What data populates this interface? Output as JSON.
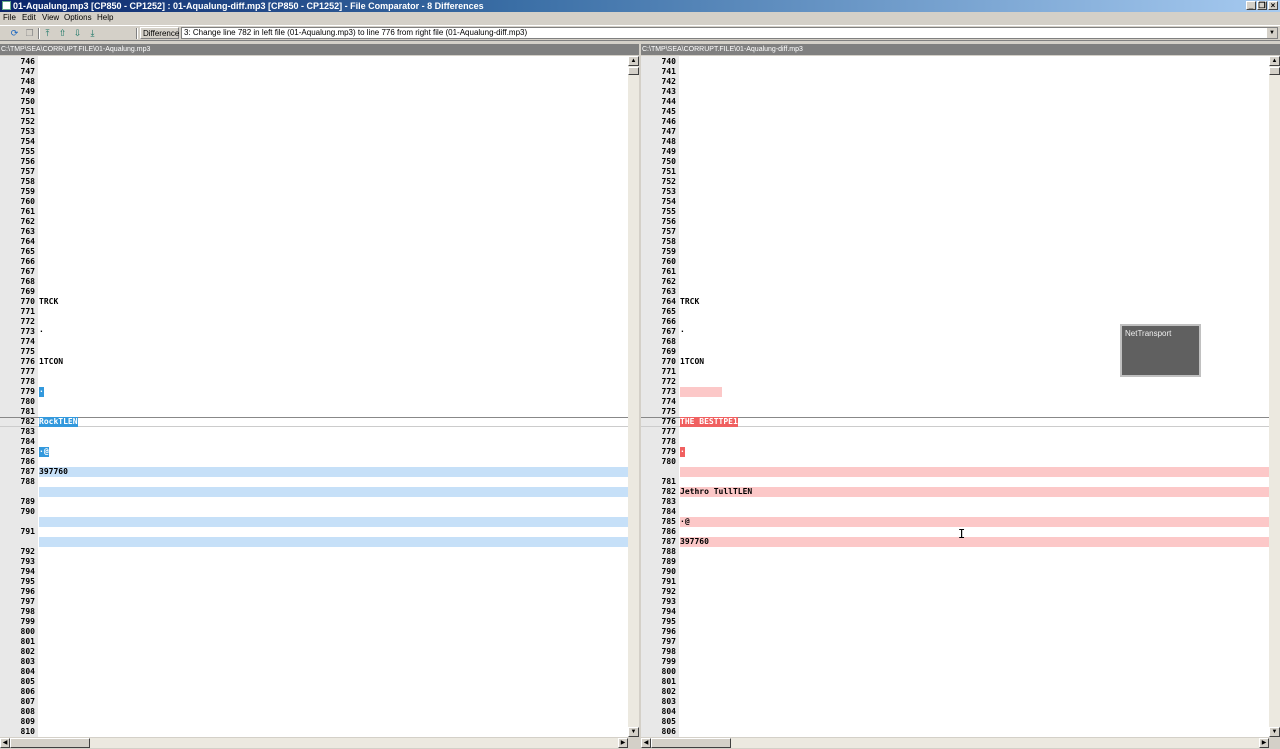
{
  "window": {
    "title": "01-Aqualung.mp3 [CP850 - CP1252] : 01-Aqualung-diff.mp3 [CP850 - CP1252] - File Comparator - 8 Differences",
    "controls": [
      "_",
      "❐",
      "×"
    ]
  },
  "menu": [
    {
      "label": "File"
    },
    {
      "label": "Edit"
    },
    {
      "label": "View"
    },
    {
      "label": "Options"
    },
    {
      "label": "Help"
    }
  ],
  "toolbar": {
    "difference_label": "Difference",
    "difference_value": "3: Change line 782 in left file (01-Aqualung.mp3) to line 776 from right file (01-Aqualung-diff.mp3)"
  },
  "left_pane": {
    "path": "C:\\TMP\\SEA\\CORRUPT.FILE\\01-Aqualung.mp3"
  },
  "right_pane": {
    "path": "C:\\TMP\\SEA\\CORRUPT.FILE\\01-Aqualung-diff.mp3"
  },
  "left_lines": [
    {
      "n": "746",
      "t": ""
    },
    {
      "n": "747",
      "t": ""
    },
    {
      "n": "748",
      "t": ""
    },
    {
      "n": "749",
      "t": ""
    },
    {
      "n": "750",
      "t": ""
    },
    {
      "n": "751",
      "t": ""
    },
    {
      "n": "752",
      "t": ""
    },
    {
      "n": "753",
      "t": ""
    },
    {
      "n": "754",
      "t": ""
    },
    {
      "n": "755",
      "t": ""
    },
    {
      "n": "756",
      "t": ""
    },
    {
      "n": "757",
      "t": ""
    },
    {
      "n": "758",
      "t": ""
    },
    {
      "n": "759",
      "t": ""
    },
    {
      "n": "760",
      "t": ""
    },
    {
      "n": "761",
      "t": ""
    },
    {
      "n": "762",
      "t": ""
    },
    {
      "n": "763",
      "t": ""
    },
    {
      "n": "764",
      "t": ""
    },
    {
      "n": "765",
      "t": ""
    },
    {
      "n": "766",
      "t": ""
    },
    {
      "n": "767",
      "t": ""
    },
    {
      "n": "768",
      "t": ""
    },
    {
      "n": "769",
      "t": ""
    },
    {
      "n": "770",
      "t": "TRCK"
    },
    {
      "n": "771",
      "t": ""
    },
    {
      "n": "772",
      "t": ""
    },
    {
      "n": "773",
      "t": "·"
    },
    {
      "n": "774",
      "t": ""
    },
    {
      "n": "775",
      "t": ""
    },
    {
      "n": "776",
      "t": "1TCON"
    },
    {
      "n": "777",
      "t": ""
    },
    {
      "n": "778",
      "t": ""
    },
    {
      "n": "779",
      "t": "·",
      "sel": "blue"
    },
    {
      "n": "780",
      "t": ""
    },
    {
      "n": "781",
      "t": ""
    },
    {
      "n": "782",
      "t": "RockTLEN",
      "sel": "blue",
      "current": true
    },
    {
      "n": "783",
      "t": ""
    },
    {
      "n": "784",
      "t": ""
    },
    {
      "n": "785",
      "t": "·@",
      "sel": "blue"
    },
    {
      "n": "786",
      "t": ""
    },
    {
      "n": "787",
      "t": "397760",
      "hl": "blue"
    },
    {
      "n": "788",
      "t": ""
    },
    {
      "n": "",
      "t": "",
      "hl": "blue"
    },
    {
      "n": "789",
      "t": ""
    },
    {
      "n": "790",
      "t": ""
    },
    {
      "n": "",
      "t": "",
      "hl": "blue"
    },
    {
      "n": "791",
      "t": ""
    },
    {
      "n": "",
      "t": "",
      "hl": "blue"
    },
    {
      "n": "792",
      "t": ""
    },
    {
      "n": "793",
      "t": ""
    },
    {
      "n": "794",
      "t": ""
    },
    {
      "n": "795",
      "t": ""
    },
    {
      "n": "796",
      "t": ""
    },
    {
      "n": "797",
      "t": ""
    },
    {
      "n": "798",
      "t": ""
    },
    {
      "n": "799",
      "t": ""
    },
    {
      "n": "800",
      "t": ""
    },
    {
      "n": "801",
      "t": ""
    },
    {
      "n": "802",
      "t": ""
    },
    {
      "n": "803",
      "t": ""
    },
    {
      "n": "804",
      "t": ""
    },
    {
      "n": "805",
      "t": ""
    },
    {
      "n": "806",
      "t": ""
    },
    {
      "n": "807",
      "t": ""
    },
    {
      "n": "808",
      "t": ""
    },
    {
      "n": "809",
      "t": ""
    },
    {
      "n": "810",
      "t": ""
    }
  ],
  "right_lines": [
    {
      "n": "740",
      "t": ""
    },
    {
      "n": "741",
      "t": ""
    },
    {
      "n": "742",
      "t": ""
    },
    {
      "n": "743",
      "t": ""
    },
    {
      "n": "744",
      "t": ""
    },
    {
      "n": "745",
      "t": ""
    },
    {
      "n": "746",
      "t": ""
    },
    {
      "n": "747",
      "t": ""
    },
    {
      "n": "748",
      "t": ""
    },
    {
      "n": "749",
      "t": ""
    },
    {
      "n": "750",
      "t": ""
    },
    {
      "n": "751",
      "t": ""
    },
    {
      "n": "752",
      "t": ""
    },
    {
      "n": "753",
      "t": ""
    },
    {
      "n": "754",
      "t": ""
    },
    {
      "n": "755",
      "t": ""
    },
    {
      "n": "756",
      "t": ""
    },
    {
      "n": "757",
      "t": ""
    },
    {
      "n": "758",
      "t": ""
    },
    {
      "n": "759",
      "t": ""
    },
    {
      "n": "760",
      "t": ""
    },
    {
      "n": "761",
      "t": ""
    },
    {
      "n": "762",
      "t": ""
    },
    {
      "n": "763",
      "t": ""
    },
    {
      "n": "764",
      "t": "TRCK"
    },
    {
      "n": "765",
      "t": ""
    },
    {
      "n": "766",
      "t": ""
    },
    {
      "n": "767",
      "t": "·"
    },
    {
      "n": "768",
      "t": ""
    },
    {
      "n": "769",
      "t": ""
    },
    {
      "n": "770",
      "t": "1TCON"
    },
    {
      "n": "771",
      "t": ""
    },
    {
      "n": "772",
      "t": ""
    },
    {
      "n": "773",
      "t": "",
      "small": "red"
    },
    {
      "n": "774",
      "t": ""
    },
    {
      "n": "775",
      "t": ""
    },
    {
      "n": "776",
      "t": "THE BESTTPE1",
      "sel": "red",
      "current": true
    },
    {
      "n": "777",
      "t": ""
    },
    {
      "n": "778",
      "t": ""
    },
    {
      "n": "779",
      "t": "·",
      "sel": "red"
    },
    {
      "n": "780",
      "t": ""
    },
    {
      "n": "",
      "t": "",
      "hl": "red"
    },
    {
      "n": "781",
      "t": ""
    },
    {
      "n": "782",
      "t": "Jethro TullTLEN",
      "hl": "red"
    },
    {
      "n": "783",
      "t": ""
    },
    {
      "n": "784",
      "t": ""
    },
    {
      "n": "785",
      "t": "·@",
      "hl": "red"
    },
    {
      "n": "786",
      "t": ""
    },
    {
      "n": "787",
      "t": "397760",
      "hl": "red"
    },
    {
      "n": "788",
      "t": ""
    },
    {
      "n": "789",
      "t": ""
    },
    {
      "n": "790",
      "t": ""
    },
    {
      "n": "791",
      "t": ""
    },
    {
      "n": "792",
      "t": ""
    },
    {
      "n": "793",
      "t": ""
    },
    {
      "n": "794",
      "t": ""
    },
    {
      "n": "795",
      "t": ""
    },
    {
      "n": "796",
      "t": ""
    },
    {
      "n": "797",
      "t": ""
    },
    {
      "n": "798",
      "t": ""
    },
    {
      "n": "799",
      "t": ""
    },
    {
      "n": "800",
      "t": ""
    },
    {
      "n": "801",
      "t": ""
    },
    {
      "n": "802",
      "t": ""
    },
    {
      "n": "803",
      "t": ""
    },
    {
      "n": "804",
      "t": ""
    },
    {
      "n": "805",
      "t": ""
    },
    {
      "n": "806",
      "t": ""
    }
  ],
  "popup": {
    "label": "NetTransport"
  },
  "colors": {
    "diff_left": "#c6e0f8",
    "diff_right": "#fcc8c8",
    "select_left": "#3399dd",
    "select_right": "#f06060"
  }
}
